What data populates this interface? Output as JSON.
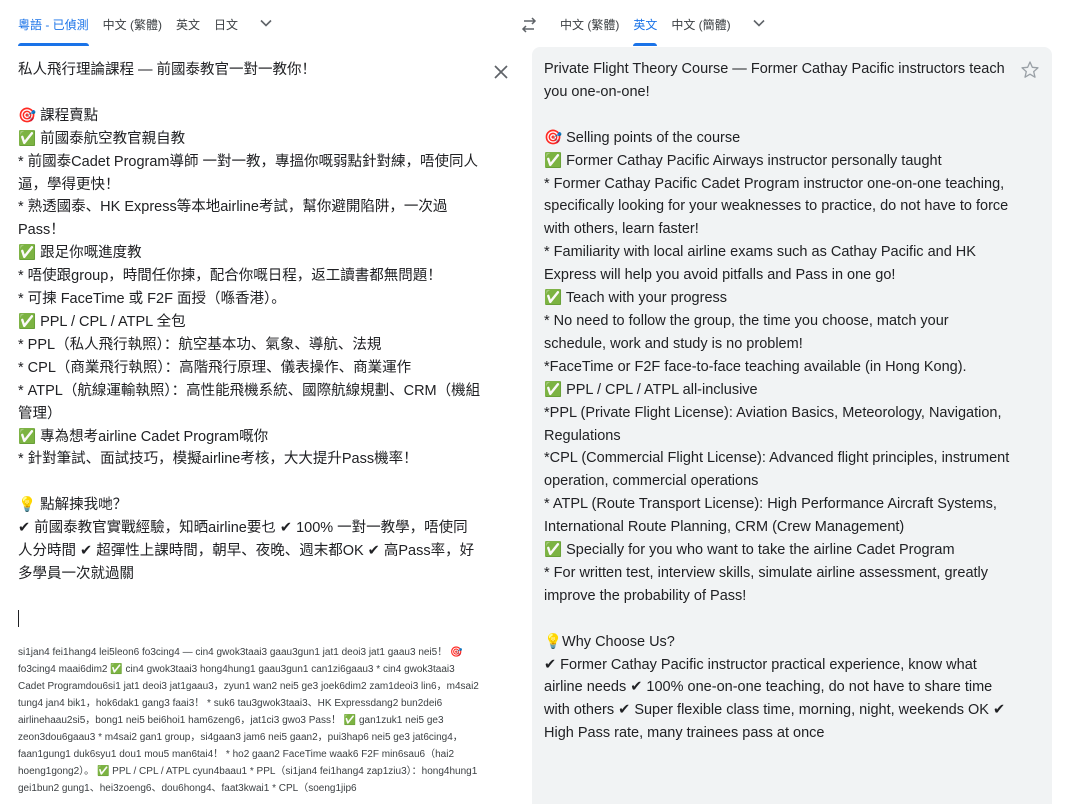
{
  "source_languages": {
    "tabs": [
      "粵語 - 已偵測",
      "中文 (繁體)",
      "英文",
      "日文"
    ],
    "active_index": 0
  },
  "target_languages": {
    "tabs": [
      "中文 (繁體)",
      "英文",
      "中文 (簡體)"
    ],
    "active_index": 1
  },
  "icons": {
    "more_source": "chevron-down-icon",
    "swap": "swap-icon",
    "more_target": "chevron-down-icon",
    "clear": "close-icon",
    "save": "star-icon"
  },
  "colors": {
    "accent": "#1a73e8",
    "panel_bg": "#f1f3f4",
    "check_green": "#34a853"
  },
  "source_text": "私人飛行理論課程 — 前國泰教官一對一教你！\n\n🎯 課程賣點\n✅ 前國泰航空教官親自教\n* 前國泰Cadet Program導師 一對一教，專搵你嘅弱點針對練，唔使同人逼，學得更快！\n* 熟透國泰、HK Express等本地airline考試，幫你避開陷阱，一次過Pass！\n✅ 跟足你嘅進度教\n* 唔使跟group，時間任你揀，配合你嘅日程，返工讀書都無問題！\n* 可揀 FaceTime 或 F2F 面授（喺香港）。\n✅ PPL / CPL / ATPL 全包\n* PPL（私人飛行執照）：航空基本功、氣象、導航、法規\n* CPL（商業飛行執照）：高階飛行原理、儀表操作、商業運作\n* ATPL（航線運輸執照）：高性能飛機系統、國際航線規劃、CRM（機組管理）\n✅ 專為想考airline Cadet Program嘅你\n* 針對筆試、面試技巧，模擬airline考核，大大提升Pass機率！\n\n💡 點解揀我哋？\n✔ 前國泰教官實戰經驗，知晒airline要乜 ✔ 100% 一對一教學，唔使同人分時間 ✔ 超彈性上課時間，朝早、夜晚、週末都OK ✔ 高Pass率，好多學員一次就過關",
  "romanization": "si1jan4 fei1hang4 lei5leon6 fo3cing4 — cin4 gwok3taai3 gaau3gun1 jat1 deoi3 jat1 gaau3 nei5！ 🎯 fo3cing4 maai6dim2 ✅ cin4 gwok3taai3 hong4hung1 gaau3gun1 can1zi6gaau3 * cin4 gwok3taai3 Cadet Programdou6si1 jat1 deoi3 jat1gaau3，zyun1 wan2 nei5 ge3 joek6dim2 zam1deoi3 lin6，m4sai2 tung4 jan4 bik1，hok6dak1 gang3 faai3！ * suk6 tau3gwok3taai3、HK Expressdang2 bun2dei6 airlinehaau2si5，bong1 nei5 bei6hoi1 ham6zeng6，jat1ci3 gwo3 Pass！ ✅ gan1zuk1 nei5 ge3 zeon3dou6gaau3 * m4sai2 gan1 group，si4gaan3 jam6 nei5 gaan2，pui3hap6 nei5 ge3 jat6cing4，faan1gung1 duk6syu1 dou1 mou5 man6tai4！ * ho2 gaan2 FaceTime waak6 F2F min6sau6（hai2 hoeng1gong2）。 ✅ PPL / CPL / ATPL cyun4baau1 * PPL（si1jan4 fei1hang4 zap1ziu3）：hong4hung1 gei1bun2 gung1、hei3zoeng6、dou6hong4、faat3kwai1 * CPL（soeng1jip6",
  "target_text": "Private Flight Theory Course — Former Cathay Pacific instructors teach you one-on-one!\n\n🎯 Selling points of the course\n✅ Former Cathay Pacific Airways instructor personally taught\n* Former Cathay Pacific Cadet Program instructor one-on-one teaching, specifically looking for your weaknesses to practice, do not have to force with others, learn faster!\n* Familiarity with local airline exams such as Cathay Pacific and HK Express will help you avoid pitfalls and Pass in one go!\n✅ Teach with your progress\n* No need to follow the group, the time you choose, match your schedule, work and study is no problem!\n*FaceTime or F2F face-to-face teaching available (in Hong Kong).\n✅ PPL / CPL / ATPL all-inclusive\n*PPL (Private Flight License): Aviation Basics, Meteorology, Navigation, Regulations\n*CPL (Commercial Flight License): Advanced flight principles, instrument operation, commercial operations\n* ATPL (Route Transport License): High Performance Aircraft Systems, International Route Planning, CRM (Crew Management)\n✅ Specially for you who want to take the airline Cadet Program\n* For written test, interview skills, simulate airline assessment, greatly improve the probability of Pass!\n\n💡Why Choose Us?\n✔ Former Cathay Pacific instructor practical experience, know what airline needs ✔ 100% one-on-one teaching, do not have to share time with others ✔ Super flexible class time, morning, night, weekends OK ✔ High Pass rate, many trainees pass at once"
}
